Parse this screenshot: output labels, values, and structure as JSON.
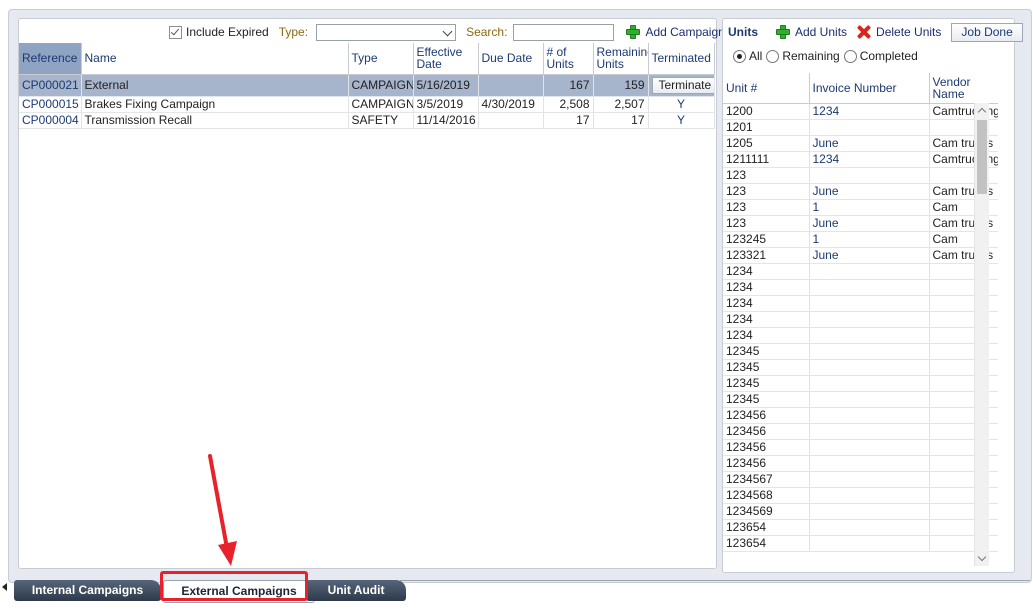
{
  "campaigns_toolbar": {
    "include_expired_label": "Include Expired",
    "type_label": "Type:",
    "type_value": "",
    "search_label": "Search:",
    "search_value": "",
    "add_campaign_label": "Add Campaign"
  },
  "campaigns_table": {
    "columns": [
      "Reference",
      "Name",
      "Type",
      "Effective Date",
      "Due Date",
      "# of Units",
      "Remaining Units",
      "Terminated"
    ],
    "rows": [
      {
        "reference": "CP000021",
        "name": "External",
        "type": "CAMPAIGN",
        "effective": "5/16/2019",
        "due": "",
        "units": "167",
        "remaining": "159",
        "terminated": "Terminate",
        "selected": true
      },
      {
        "reference": "CP000015",
        "name": "Brakes Fixing Campaign",
        "type": "CAMPAIGN",
        "effective": "3/5/2019",
        "due": "4/30/2019",
        "units": "2,508",
        "remaining": "2,507",
        "terminated": "Y"
      },
      {
        "reference": "CP000004",
        "name": "Transmission Recall",
        "type": "SAFETY",
        "effective": "11/14/2016",
        "due": "",
        "units": "17",
        "remaining": "17",
        "terminated": "Y"
      }
    ]
  },
  "units_panel": {
    "title": "Units",
    "add_units_label": "Add Units",
    "delete_units_label": "Delete Units",
    "job_done_label": "Job Done",
    "filter_all": "All",
    "filter_remaining": "Remaining",
    "filter_completed": "Completed",
    "selected_filter": "All",
    "columns": [
      "Unit #",
      "Invoice Number",
      "Vendor Name"
    ],
    "rows": [
      [
        "1200",
        "1234",
        "Camtrucking"
      ],
      [
        "1201",
        "",
        ""
      ],
      [
        "1205",
        "June",
        "Cam trucks"
      ],
      [
        "1211111",
        "1234",
        "Camtrucking"
      ],
      [
        "123",
        "",
        ""
      ],
      [
        "123",
        "June",
        "Cam trucks"
      ],
      [
        "123",
        "1",
        "Cam"
      ],
      [
        "123",
        "June",
        "Cam trucks"
      ],
      [
        "123245",
        "1",
        "Cam"
      ],
      [
        "123321",
        "June",
        "Cam trucks"
      ],
      [
        "1234",
        "",
        ""
      ],
      [
        "1234",
        "",
        ""
      ],
      [
        "1234",
        "",
        ""
      ],
      [
        "1234",
        "",
        ""
      ],
      [
        "1234",
        "",
        ""
      ],
      [
        "12345",
        "",
        ""
      ],
      [
        "12345",
        "",
        ""
      ],
      [
        "12345",
        "",
        ""
      ],
      [
        "12345",
        "",
        ""
      ],
      [
        "123456",
        "",
        ""
      ],
      [
        "123456",
        "",
        ""
      ],
      [
        "123456",
        "",
        ""
      ],
      [
        "123456",
        "",
        ""
      ],
      [
        "1234567",
        "",
        ""
      ],
      [
        "1234568",
        "",
        ""
      ],
      [
        "1234569",
        "",
        ""
      ],
      [
        "123654",
        "",
        ""
      ],
      [
        "123654",
        "",
        ""
      ]
    ]
  },
  "tabs": [
    {
      "label": "Internal Campaigns",
      "active": false
    },
    {
      "label": "External Campaigns",
      "active": true
    },
    {
      "label": "Unit Audit",
      "active": false
    }
  ],
  "annotation_color": "#e8222a"
}
